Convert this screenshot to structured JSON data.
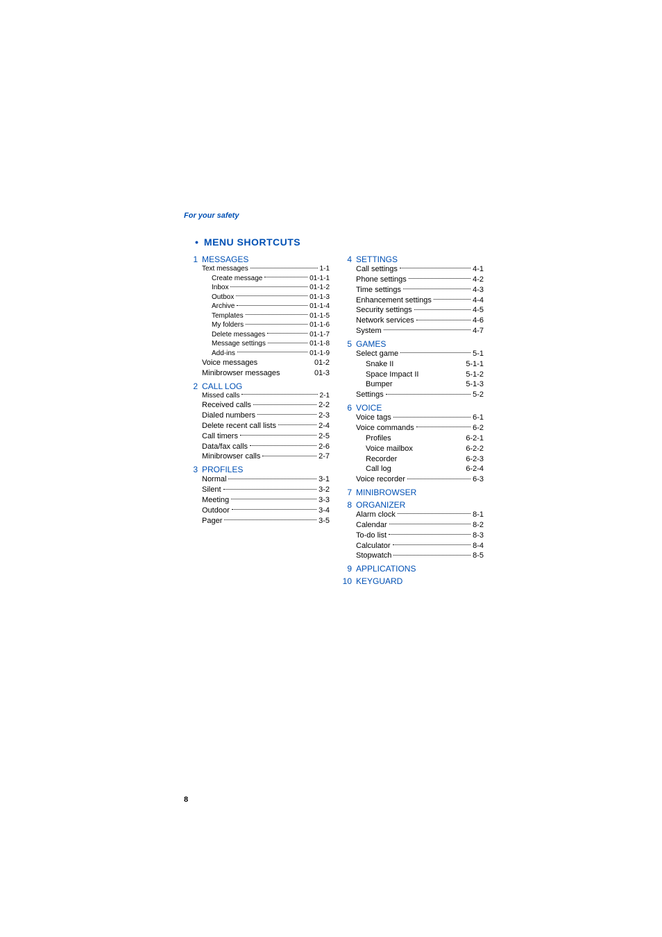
{
  "header": "For your safety",
  "title": "MENU SHORTCUTS",
  "page_number": "8",
  "left": [
    {
      "num": "1",
      "title": "MESSAGES",
      "items": [
        {
          "label": "Text messages",
          "ref": "1-1",
          "dots": true,
          "sm": true
        },
        {
          "label": "Create message",
          "ref": "01-1-1",
          "dots": true,
          "sm": true,
          "indent": true
        },
        {
          "label": "Inbox",
          "ref": "01-1-2",
          "dots": true,
          "sm": true,
          "indent": true
        },
        {
          "label": "Outbox",
          "ref": "01-1-3",
          "dots": true,
          "sm": true,
          "indent": true
        },
        {
          "label": "Archive",
          "ref": "01-1-4",
          "dots": true,
          "sm": true,
          "indent": true
        },
        {
          "label": "Templates",
          "ref": "01-1-5",
          "dots": true,
          "sm": true,
          "indent": true
        },
        {
          "label": "My folders",
          "ref": "01-1-6",
          "dots": true,
          "sm": true,
          "indent": true
        },
        {
          "label": "Delete messages",
          "ref": "01-1-7",
          "dots": true,
          "sm": true,
          "indent": true
        },
        {
          "label": "Message settings",
          "ref": "01-1-8",
          "dots": true,
          "sm": true,
          "indent": true
        },
        {
          "label": "Add-ins",
          "ref": "01-1-9",
          "dots": true,
          "sm": true,
          "indent": true
        },
        {
          "label": "Voice messages",
          "ref": "01-2",
          "dots": false
        },
        {
          "label": "Minibrowser messages",
          "ref": "01-3",
          "dots": false
        }
      ]
    },
    {
      "num": "2",
      "title": "CALL LOG",
      "items": [
        {
          "label": "Missed calls",
          "ref": "2-1",
          "dots": true,
          "sm": true
        },
        {
          "label": "Received calls",
          "ref": "2-2",
          "dots": true
        },
        {
          "label": "Dialed numbers",
          "ref": "2-3",
          "dots": true
        },
        {
          "label": "Delete recent call lists",
          "ref": "2-4",
          "dots": true
        },
        {
          "label": "Call timers",
          "ref": "2-5",
          "dots": true
        },
        {
          "label": "Data/fax calls",
          "ref": "2-6",
          "dots": true
        },
        {
          "label": "Minibrowser calls",
          "ref": "2-7",
          "dots": true
        }
      ]
    },
    {
      "num": "3",
      "title": "PROFILES",
      "items": [
        {
          "label": "Normal",
          "ref": "3-1",
          "dots": true
        },
        {
          "label": "Silent",
          "ref": "3-2",
          "dots": true
        },
        {
          "label": "Meeting",
          "ref": "3-3",
          "dots": true
        },
        {
          "label": "Outdoor",
          "ref": "3-4",
          "dots": true
        },
        {
          "label": "Pager",
          "ref": "3-5",
          "dots": true
        }
      ]
    }
  ],
  "right": [
    {
      "num": "4",
      "title": "SETTINGS",
      "items": [
        {
          "label": "Call settings",
          "ref": "4-1",
          "dots": true
        },
        {
          "label": "Phone settings",
          "ref": "4-2",
          "dots": true
        },
        {
          "label": "Time settings",
          "ref": "4-3",
          "dots": true
        },
        {
          "label": "Enhancement settings",
          "ref": "4-4",
          "dots": true
        },
        {
          "label": "Security settings",
          "ref": "4-5",
          "dots": true
        },
        {
          "label": "Network services",
          "ref": "4-6",
          "dots": true
        },
        {
          "label": "System",
          "ref": "4-7",
          "dots": true
        }
      ]
    },
    {
      "num": "5",
      "title": "GAMES",
      "items": [
        {
          "label": "Select game",
          "ref": "5-1",
          "dots": true
        },
        {
          "label": "Snake II",
          "ref": "5-1-1",
          "dots": false,
          "indent": true
        },
        {
          "label": "Space Impact II",
          "ref": "5-1-2",
          "dots": false,
          "indent": true
        },
        {
          "label": "Bumper",
          "ref": "5-1-3",
          "dots": false,
          "indent": true
        },
        {
          "label": "Settings",
          "ref": "5-2",
          "dots": true
        }
      ]
    },
    {
      "num": "6",
      "title": "VOICE",
      "items": [
        {
          "label": "Voice tags",
          "ref": "6-1",
          "dots": true
        },
        {
          "label": "Voice commands",
          "ref": "6-2",
          "dots": true
        },
        {
          "label": "Profiles",
          "ref": "6-2-1",
          "dots": false,
          "indent": true
        },
        {
          "label": "Voice mailbox",
          "ref": "6-2-2",
          "dots": false,
          "indent": true
        },
        {
          "label": "Recorder",
          "ref": "6-2-3",
          "dots": false,
          "indent": true
        },
        {
          "label": "Call log",
          "ref": "6-2-4",
          "dots": false,
          "indent": true
        },
        {
          "label": "Voice recorder",
          "ref": "6-3",
          "dots": true
        }
      ]
    },
    {
      "num": "7",
      "title": "MINIBROWSER",
      "items": []
    },
    {
      "num": "8",
      "title": "ORGANIZER",
      "items": [
        {
          "label": "Alarm clock",
          "ref": "8-1",
          "dots": true
        },
        {
          "label": "Calendar",
          "ref": "8-2",
          "dots": true
        },
        {
          "label": "To-do list",
          "ref": "8-3",
          "dots": true
        },
        {
          "label": "Calculator",
          "ref": "8-4",
          "dots": true
        },
        {
          "label": "Stopwatch",
          "ref": "8-5",
          "dots": true
        }
      ]
    },
    {
      "num": "9",
      "title": "APPLICATIONS",
      "items": []
    },
    {
      "num": "10",
      "title": "KEYGUARD",
      "items": []
    }
  ]
}
